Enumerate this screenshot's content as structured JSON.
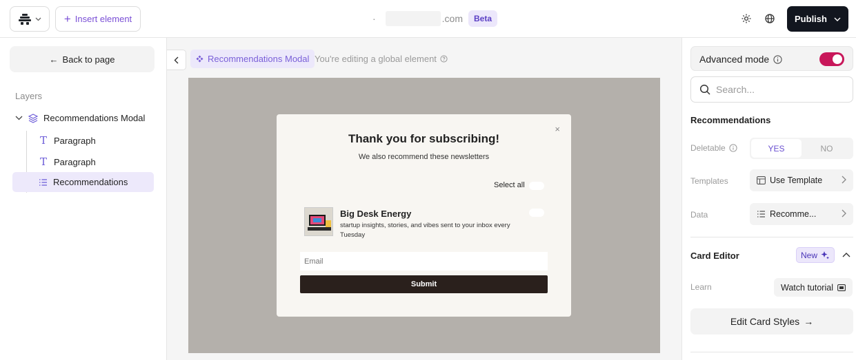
{
  "topbar": {
    "insert_label": "Insert element",
    "domain_prefix": "·",
    "domain_suffix": ".com",
    "beta_label": "Beta",
    "publish_label": "Publish"
  },
  "left": {
    "back_label": "Back to page",
    "layers_title": "Layers",
    "tree": {
      "root": "Recommendations Modal",
      "children": [
        "Paragraph",
        "Paragraph",
        "Recommendations"
      ]
    }
  },
  "canvas": {
    "breadcrumb": "Recommendations Modal",
    "note": "You're editing a global element",
    "modal": {
      "close": "×",
      "title": "Thank you for subscribing!",
      "subtitle": "We also recommend these newsletters",
      "select_all": "Select all",
      "rec_name": "Big Desk Energy",
      "rec_desc": "startup insights, stories, and vibes sent to your inbox every Tuesday",
      "email_placeholder": "Email",
      "submit_label": "Submit"
    }
  },
  "right": {
    "advanced_label": "Advanced mode",
    "advanced_on": true,
    "search_placeholder": "Search...",
    "section_recommendations": "Recommendations",
    "deletable_label": "Deletable",
    "deletable_yes": "YES",
    "deletable_no": "NO",
    "templates_label": "Templates",
    "templates_value": "Use Template",
    "data_label": "Data",
    "data_value": "Recomme...",
    "card_editor_title": "Card Editor",
    "new_badge": "New",
    "learn_label": "Learn",
    "watch_label": "Watch tutorial",
    "edit_styles_label": "Edit Card Styles"
  },
  "colors": {
    "accent": "#7a4fd6",
    "toggle_on": "#c8175a",
    "publish_bg": "#12161f",
    "stage_bg": "#b4b0ab",
    "submit_bg": "#2a201c"
  }
}
